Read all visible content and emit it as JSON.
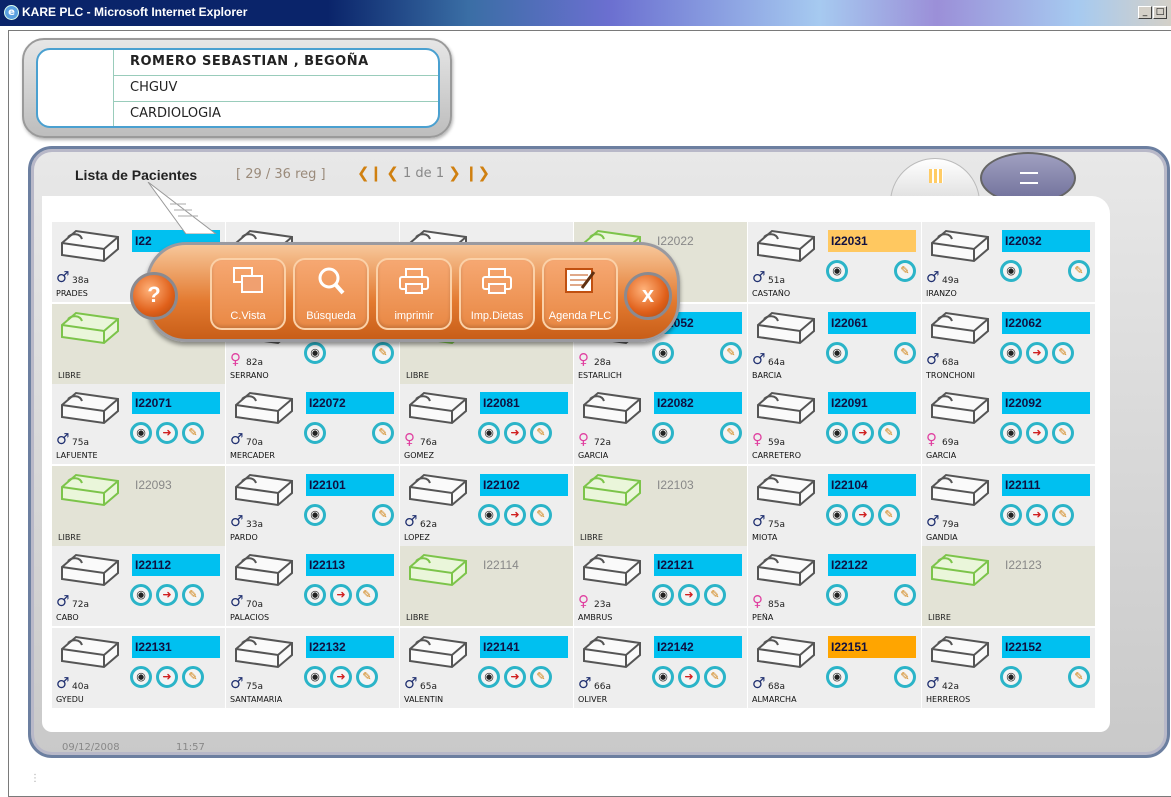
{
  "window": {
    "title": "KARE PLC - Microsoft Internet Explorer"
  },
  "patient": {
    "name": "ROMERO SEBASTIAN , BEGOÑA",
    "hospital": "CHGUV",
    "service": "CARDIOLOGIA"
  },
  "list": {
    "title": "Lista de Pacientes",
    "records": "[ 29 / 36  reg ]",
    "page": "1",
    "of": "de",
    "total": "1"
  },
  "footer": {
    "date": "09/12/2008",
    "time": "11:57"
  },
  "popup": {
    "help": "?",
    "close": "x",
    "buttons": [
      {
        "label": "C.Vista",
        "icon": "windows-icon"
      },
      {
        "label": "Búsqueda",
        "icon": "magnifier-icon"
      },
      {
        "label": "imprimir",
        "icon": "printer-icon"
      },
      {
        "label": "Imp.Dietas",
        "icon": "printer-icon"
      },
      {
        "label": "Agenda PLC",
        "icon": "agenda-icon"
      }
    ]
  },
  "colors": {
    "bed_id": "#00c0f0",
    "bed_id_alert": "#ffa500",
    "bed_id_warn": "#ffc860",
    "popup": "#e37a30",
    "icon_ring": "#2bb4c8",
    "male": "#203070",
    "female": "#e040a0"
  },
  "beds": [
    [
      {
        "id": "I22",
        "status": "occ",
        "gender": "m",
        "age": "38a",
        "name": "PRADES",
        "icons": []
      },
      {
        "id": "",
        "status": "occ",
        "gender": "",
        "age": "",
        "name": "",
        "icons": []
      },
      {
        "id": "",
        "status": "occ",
        "gender": "",
        "age": "",
        "name": "",
        "icons": []
      },
      {
        "id": "I22022",
        "status": "libre",
        "label": "",
        "icons": []
      },
      {
        "id": "I22031",
        "status": "occ",
        "color": "lightorange",
        "gender": "m",
        "age": "51a",
        "name": "CASTAÑO",
        "icons": [
          "eye",
          "diet"
        ]
      },
      {
        "id": "I22032",
        "status": "occ",
        "gender": "m",
        "age": "49a",
        "name": "IRANZO",
        "icons": [
          "eye",
          "diet"
        ]
      }
    ],
    [
      {
        "id": "",
        "status": "libre",
        "label": "LIBRE",
        "icons": []
      },
      {
        "id": "",
        "status": "occ",
        "gender": "f",
        "age": "82a",
        "name": "SERRANO",
        "icons": [
          "eye",
          "diet"
        ]
      },
      {
        "id": "",
        "status": "libre",
        "label": "LIBRE",
        "icons": []
      },
      {
        "id": "I22052",
        "status": "occ",
        "gender": "f",
        "age": "28a",
        "name": "ESTARLICH",
        "icons": [
          "eye",
          "diet"
        ]
      },
      {
        "id": "I22061",
        "status": "occ",
        "gender": "m",
        "age": "64a",
        "name": "BARCIA",
        "icons": [
          "eye",
          "diet"
        ]
      },
      {
        "id": "I22062",
        "status": "occ",
        "gender": "m",
        "age": "68a",
        "name": "TRONCHONI",
        "icons": [
          "eye",
          "exit",
          "diet"
        ]
      }
    ],
    [
      {
        "id": "I22071",
        "status": "occ",
        "gender": "m",
        "age": "75a",
        "name": "LAFUENTE",
        "icons": [
          "eye",
          "exit",
          "diet"
        ]
      },
      {
        "id": "I22072",
        "status": "occ",
        "gender": "m",
        "age": "70a",
        "name": "MERCADER",
        "icons": [
          "eye",
          "diet"
        ]
      },
      {
        "id": "I22081",
        "status": "occ",
        "gender": "f",
        "age": "76a",
        "name": "GOMEZ",
        "icons": [
          "eye",
          "exit",
          "diet"
        ]
      },
      {
        "id": "I22082",
        "status": "occ",
        "gender": "f",
        "age": "72a",
        "name": "GARCIA",
        "icons": [
          "eye",
          "diet"
        ]
      },
      {
        "id": "I22091",
        "status": "occ",
        "gender": "f",
        "age": "59a",
        "name": "CARRETERO",
        "icons": [
          "eye",
          "exit",
          "diet"
        ]
      },
      {
        "id": "I22092",
        "status": "occ",
        "gender": "f",
        "age": "69a",
        "name": "GARCIA",
        "icons": [
          "eye",
          "exit",
          "diet"
        ]
      }
    ],
    [
      {
        "id": "I22093",
        "status": "libre",
        "label": "LIBRE",
        "icons": []
      },
      {
        "id": "I22101",
        "status": "occ",
        "gender": "m",
        "age": "33a",
        "name": "PARDO",
        "icons": [
          "eye",
          "diet"
        ]
      },
      {
        "id": "I22102",
        "status": "occ",
        "gender": "m",
        "age": "62a",
        "name": "LOPEZ",
        "icons": [
          "eye",
          "exit",
          "diet"
        ]
      },
      {
        "id": "I22103",
        "status": "libre",
        "label": "LIBRE",
        "icons": []
      },
      {
        "id": "I22104",
        "status": "occ",
        "gender": "m",
        "age": "75a",
        "name": "MIOTA",
        "icons": [
          "eye",
          "exit",
          "diet"
        ]
      },
      {
        "id": "I22111",
        "status": "occ",
        "gender": "m",
        "age": "79a",
        "name": "GANDIA",
        "icons": [
          "eye",
          "exit",
          "diet"
        ]
      }
    ],
    [
      {
        "id": "I22112",
        "status": "occ",
        "gender": "m",
        "age": "72a",
        "name": "CABO",
        "icons": [
          "eye",
          "exit",
          "diet"
        ]
      },
      {
        "id": "I22113",
        "status": "occ",
        "gender": "m",
        "age": "70a",
        "name": "PALACIOS",
        "icons": [
          "eye",
          "exit",
          "diet"
        ]
      },
      {
        "id": "I22114",
        "status": "libre",
        "label": "LIBRE",
        "icons": []
      },
      {
        "id": "I22121",
        "status": "occ",
        "gender": "f",
        "age": "23a",
        "name": "AMBRUS",
        "icons": [
          "eye",
          "exit",
          "diet"
        ]
      },
      {
        "id": "I22122",
        "status": "occ",
        "gender": "f",
        "age": "85a",
        "name": "PEÑA",
        "icons": [
          "eye",
          "diet"
        ]
      },
      {
        "id": "I22123",
        "status": "libre",
        "label": "LIBRE",
        "icons": []
      }
    ],
    [
      {
        "id": "I22131",
        "status": "occ",
        "gender": "m",
        "age": "40a",
        "name": "GYEDU",
        "icons": [
          "eye",
          "exit",
          "diet"
        ]
      },
      {
        "id": "I22132",
        "status": "occ",
        "gender": "m",
        "age": "75a",
        "name": "SANTAMARIA",
        "icons": [
          "eye",
          "exit",
          "diet"
        ]
      },
      {
        "id": "I22141",
        "status": "occ",
        "gender": "m",
        "age": "65a",
        "name": "VALENTIN",
        "icons": [
          "eye",
          "exit",
          "diet"
        ]
      },
      {
        "id": "I22142",
        "status": "occ",
        "gender": "m",
        "age": "66a",
        "name": "OLIVER",
        "icons": [
          "eye",
          "exit",
          "diet"
        ]
      },
      {
        "id": "I22151",
        "status": "occ",
        "color": "orange",
        "gender": "m",
        "age": "68a",
        "name": "ALMARCHA",
        "icons": [
          "eye",
          "diet"
        ]
      },
      {
        "id": "I22152",
        "status": "occ",
        "gender": "m",
        "age": "42a",
        "name": "HERREROS",
        "icons": [
          "eye",
          "diet"
        ]
      }
    ]
  ]
}
